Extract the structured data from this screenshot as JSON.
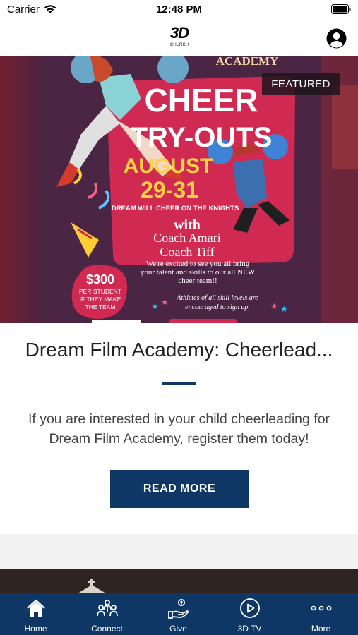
{
  "status_bar": {
    "carrier": "Carrier",
    "time": "12:48 PM"
  },
  "nav": {
    "logo_text": "3D",
    "logo_subtext": "CHURCH"
  },
  "featured_card": {
    "badge": "FEATURED",
    "title": "Dream Film Academy: Cheerlead...",
    "description": "If you are interested in your child cheerleading for Dream Film Academy, register them today!",
    "read_more_label": "READ MORE",
    "flyer": {
      "academy": "ACADEMY",
      "headline_1": "CHEER",
      "headline_2": "TRY-OUTS",
      "month": "AUGUST",
      "dates": "29-31",
      "tagline": "DREAM WILL CHEER ON THE KNIGHTS",
      "with": "with",
      "coach_1": "Coach Amari",
      "coach_2": "Coach Tiff",
      "excited_1": "We're excited to see you all bring",
      "excited_2": "your talent and skills to our all NEW",
      "excited_3": "cheer team!!",
      "price": "$300",
      "price_note_1": "PER STUDENT",
      "price_note_2": "IF THEY MAKE",
      "price_note_3": "THE TEAM",
      "levels_1": "Athletes of all skill levels are",
      "levels_2": "encouraged to sign up."
    }
  },
  "tabs": [
    {
      "label": "Home",
      "icon": "home-icon"
    },
    {
      "label": "Connect",
      "icon": "people-icon"
    },
    {
      "label": "Give",
      "icon": "give-hand-icon"
    },
    {
      "label": "3D TV",
      "icon": "play-circle-icon"
    },
    {
      "label": "More",
      "icon": "more-dots-icon"
    }
  ]
}
